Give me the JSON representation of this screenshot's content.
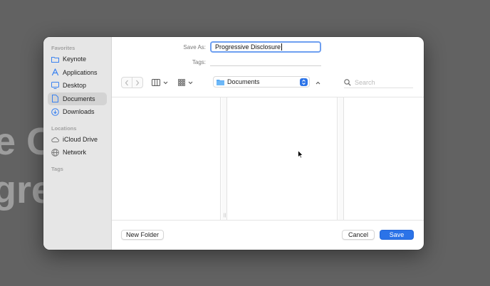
{
  "background": {
    "line1": "e C",
    "line2": "gre"
  },
  "sidebar": {
    "sections": [
      {
        "header": "Favorites",
        "items": [
          {
            "label": "Keynote",
            "icon": "folder-icon",
            "selected": false
          },
          {
            "label": "Applications",
            "icon": "applications-icon",
            "selected": false
          },
          {
            "label": "Desktop",
            "icon": "desktop-icon",
            "selected": false
          },
          {
            "label": "Documents",
            "icon": "document-icon",
            "selected": true
          },
          {
            "label": "Downloads",
            "icon": "download-icon",
            "selected": false
          }
        ]
      },
      {
        "header": "Locations",
        "items": [
          {
            "label": "iCloud Drive",
            "icon": "cloud-icon",
            "selected": false
          },
          {
            "label": "Network",
            "icon": "globe-icon",
            "selected": false
          }
        ]
      },
      {
        "header": "Tags",
        "items": []
      }
    ]
  },
  "form": {
    "save_as_label": "Save As:",
    "save_as_value": "Progressive Disclosure",
    "tags_label": "Tags:",
    "tags_value": ""
  },
  "toolbar": {
    "location": "Documents",
    "search_placeholder": "Search"
  },
  "footer": {
    "new_folder_label": "New Folder",
    "cancel_label": "Cancel",
    "save_label": "Save"
  },
  "colors": {
    "accent": "#2b73e8",
    "backdrop": "#626262",
    "sidebar_bg": "#e6e6e6"
  }
}
